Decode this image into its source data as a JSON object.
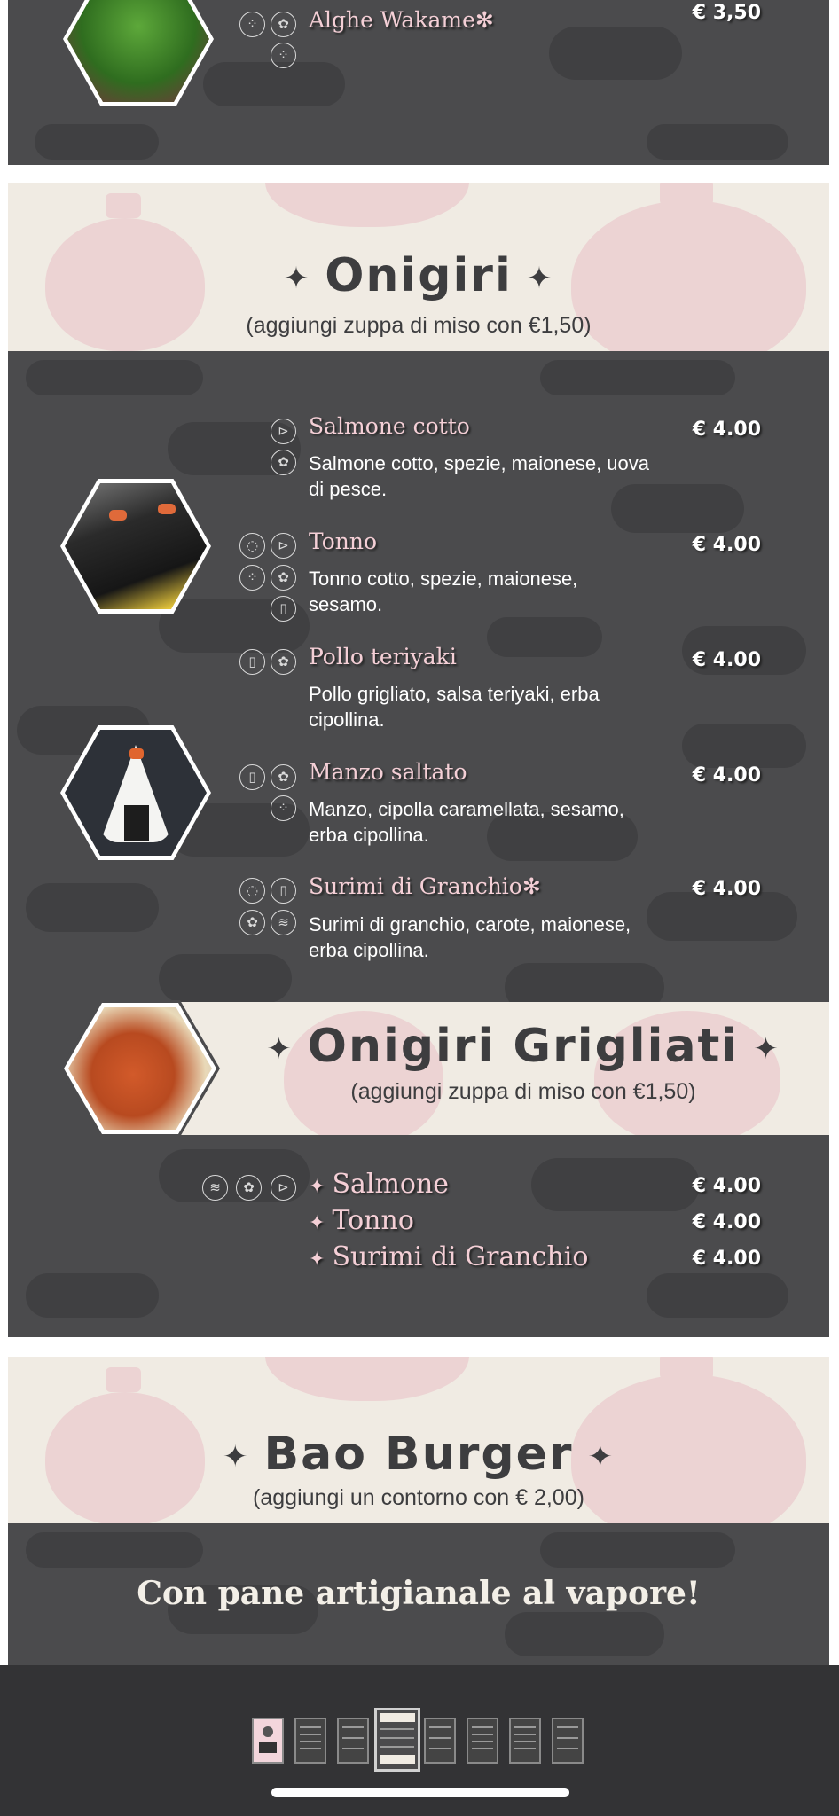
{
  "seaweed": {
    "name": "Alghe Wakame✻",
    "price": "€ 3,50"
  },
  "onigiri": {
    "title": "Onigiri",
    "subtitle": "(aggiungi zuppa di miso con €1,50)",
    "items": [
      {
        "name": "Salmone cotto",
        "desc": "Salmone cotto, spezie, maionese, uova di pesce.",
        "price": "€ 4.00"
      },
      {
        "name": "Tonno",
        "desc": "Tonno cotto, spezie, maionese, sesamo.",
        "price": "€ 4.00"
      },
      {
        "name": "Pollo teriyaki",
        "desc": "Pollo grigliato, salsa teriyaki, erba cipollina.",
        "price": "€ 4.00"
      },
      {
        "name": "Manzo saltato",
        "desc": "Manzo, cipolla caramellata, sesamo, erba cipollina.",
        "price": "€ 4.00"
      },
      {
        "name": "Surimi di Granchio✻",
        "desc": "Surimi di granchio, carote, maionese, erba cipollina.",
        "price": "€ 4.00"
      }
    ]
  },
  "grigliati": {
    "title": "Onigiri Grigliati",
    "subtitle": "(aggiungi zuppa di miso con €1,50)",
    "items": [
      {
        "name": "Salmone",
        "price": "€ 4.00"
      },
      {
        "name": "Tonno",
        "price": "€ 4.00"
      },
      {
        "name": "Surimi di Granchio",
        "price": "€ 4.00"
      }
    ]
  },
  "bao": {
    "title": "Bao Burger",
    "subtitle": "(aggiungi un contorno con € 2,00)",
    "tagline": "Con pane artigianale al vapore!"
  },
  "sparkle": "✦",
  "colors": {
    "card": "#4b4b4d",
    "cream": "#f0ebe3",
    "lantern": "#ecd3d3",
    "accent": "#f4cfd6"
  },
  "icons": [
    "sesame-icon",
    "wheat-icon",
    "fish-icon",
    "egg-icon",
    "soy-icon",
    "crustacean-icon"
  ],
  "viewer": {
    "thumbnails": 8,
    "active_thumbnail": 4
  }
}
